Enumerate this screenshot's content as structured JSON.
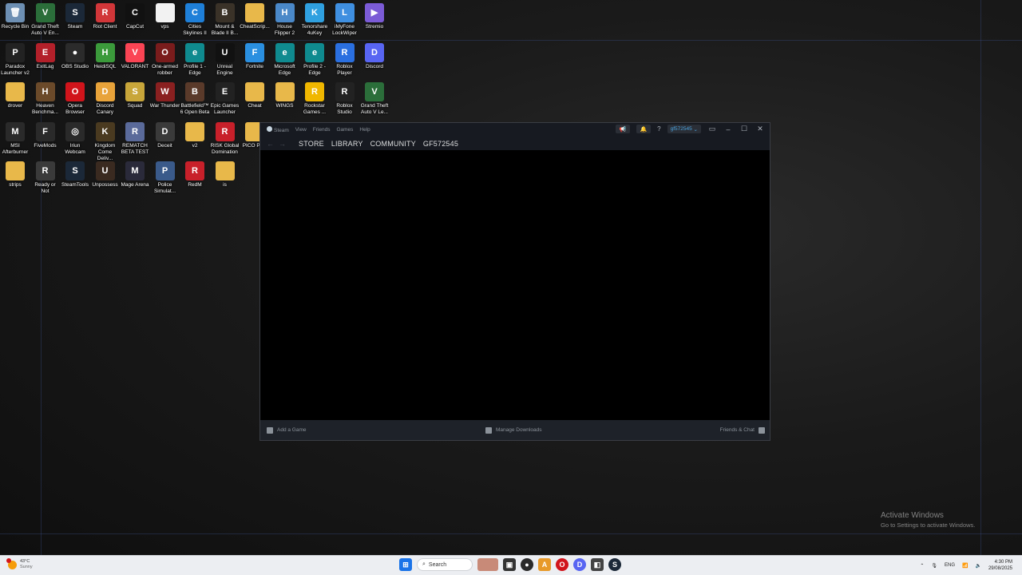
{
  "desktop": {
    "icons": [
      {
        "label": "Recycle Bin",
        "glyph": "🗑",
        "color": "#6d8fb3",
        "col": 0,
        "row": 0
      },
      {
        "label": "Grand Theft Auto V En...",
        "glyph": "V",
        "color": "#2b6e3a",
        "col": 1,
        "row": 0
      },
      {
        "label": "Steam",
        "glyph": "S",
        "color": "#1b2838",
        "col": 2,
        "row": 0
      },
      {
        "label": "Riot Client",
        "glyph": "R",
        "color": "#d13639",
        "col": 3,
        "row": 0
      },
      {
        "label": "CapCut",
        "glyph": "C",
        "color": "#111111",
        "col": 4,
        "row": 0
      },
      {
        "label": "vps",
        "glyph": "",
        "color": "#f2f2f2",
        "col": 5,
        "row": 0
      },
      {
        "label": "Cities Skylines II",
        "glyph": "C",
        "color": "#1e7fd8",
        "col": 6,
        "row": 0
      },
      {
        "label": "Mount & Blade II B...",
        "glyph": "B",
        "color": "#3a3228",
        "col": 7,
        "row": 0
      },
      {
        "label": "CheatScrip...",
        "glyph": "",
        "color": "#e8b84a",
        "col": 8,
        "row": 0
      },
      {
        "label": "House Flipper 2",
        "glyph": "H",
        "color": "#4a88c8",
        "col": 9,
        "row": 0
      },
      {
        "label": "Tenorshare 4uKey",
        "glyph": "K",
        "color": "#2fa0e0",
        "col": 10,
        "row": 0
      },
      {
        "label": "iMyFone LockWiper",
        "glyph": "L",
        "color": "#3f8fe0",
        "col": 11,
        "row": 0
      },
      {
        "label": "Stremio",
        "glyph": "▶",
        "color": "#7b5bd6",
        "col": 12,
        "row": 0
      },
      {
        "label": "Paradox Launcher v2",
        "glyph": "P",
        "color": "#222222",
        "col": 0,
        "row": 1
      },
      {
        "label": "ExitLag",
        "glyph": "E",
        "color": "#b3202a",
        "col": 1,
        "row": 1
      },
      {
        "label": "OBS Studio",
        "glyph": "●",
        "color": "#2b2b2b",
        "col": 2,
        "row": 1
      },
      {
        "label": "HeidiSQL",
        "glyph": "H",
        "color": "#3b9a3b",
        "col": 3,
        "row": 1
      },
      {
        "label": "VALORANT",
        "glyph": "V",
        "color": "#fa4454",
        "col": 4,
        "row": 1
      },
      {
        "label": "One-armed robber",
        "glyph": "O",
        "color": "#7a1c1c",
        "col": 5,
        "row": 1
      },
      {
        "label": "Profile 1 - Edge",
        "glyph": "e",
        "color": "#0f8a8f",
        "col": 6,
        "row": 1
      },
      {
        "label": "Unreal Engine",
        "glyph": "U",
        "color": "#111111",
        "col": 7,
        "row": 1
      },
      {
        "label": "Fortnite",
        "glyph": "F",
        "color": "#2a8fe0",
        "col": 8,
        "row": 1
      },
      {
        "label": "Microsoft Edge",
        "glyph": "e",
        "color": "#0f8a8f",
        "col": 9,
        "row": 1
      },
      {
        "label": "Profile 2 - Edge",
        "glyph": "e",
        "color": "#0f8a8f",
        "col": 10,
        "row": 1
      },
      {
        "label": "Roblox Player",
        "glyph": "R",
        "color": "#2a6fe0",
        "col": 11,
        "row": 1
      },
      {
        "label": "Discord",
        "glyph": "D",
        "color": "#5865f2",
        "col": 12,
        "row": 1
      },
      {
        "label": "drover",
        "glyph": "",
        "color": "#e8b84a",
        "col": 0,
        "row": 2
      },
      {
        "label": "Heaven Benchma...",
        "glyph": "H",
        "color": "#6b4a2a",
        "col": 1,
        "row": 2
      },
      {
        "label": "Opera Browser",
        "glyph": "O",
        "color": "#d1141b",
        "col": 2,
        "row": 2
      },
      {
        "label": "Discord Canary",
        "glyph": "D",
        "color": "#e8a33a",
        "col": 3,
        "row": 2
      },
      {
        "label": "Squad",
        "glyph": "S",
        "color": "#c8a63a",
        "col": 4,
        "row": 2
      },
      {
        "label": "War Thunder",
        "glyph": "W",
        "color": "#8a2020",
        "col": 5,
        "row": 2
      },
      {
        "label": "Battlefield™ 6 Open Beta",
        "glyph": "B",
        "color": "#5a3a2a",
        "col": 6,
        "row": 2
      },
      {
        "label": "Epic Games Launcher",
        "glyph": "E",
        "color": "#222222",
        "col": 7,
        "row": 2
      },
      {
        "label": "Cheat",
        "glyph": "",
        "color": "#e8b84a",
        "col": 8,
        "row": 2
      },
      {
        "label": "WINGS",
        "glyph": "",
        "color": "#e8b84a",
        "col": 9,
        "row": 2
      },
      {
        "label": "Rockstar Games ...",
        "glyph": "R",
        "color": "#f0b700",
        "col": 10,
        "row": 2
      },
      {
        "label": "Roblox Studio",
        "glyph": "R",
        "color": "#222222",
        "col": 11,
        "row": 2
      },
      {
        "label": "Grand Theft Auto V Le...",
        "glyph": "V",
        "color": "#2b6e3a",
        "col": 12,
        "row": 2
      },
      {
        "label": "MSI Afterburner",
        "glyph": "M",
        "color": "#2a2a2a",
        "col": 0,
        "row": 3
      },
      {
        "label": "FiveMods",
        "glyph": "F",
        "color": "#2a2a2a",
        "col": 1,
        "row": 3
      },
      {
        "label": "Iriun Webcam",
        "glyph": "◎",
        "color": "#2a2a2a",
        "col": 2,
        "row": 3
      },
      {
        "label": "Kingdom Come Deliv...",
        "glyph": "K",
        "color": "#4a3a20",
        "col": 3,
        "row": 3
      },
      {
        "label": "REMATCH BETA TEST",
        "glyph": "R",
        "color": "#5a6a9a",
        "col": 4,
        "row": 3
      },
      {
        "label": "Deceit",
        "glyph": "D",
        "color": "#3a3a3a",
        "col": 5,
        "row": 3
      },
      {
        "label": "v2",
        "glyph": "",
        "color": "#e8b84a",
        "col": 6,
        "row": 3
      },
      {
        "label": "RISK Global Domination",
        "glyph": "R",
        "color": "#c8202a",
        "col": 7,
        "row": 3
      },
      {
        "label": "PICO PAR",
        "glyph": "",
        "color": "#e8b84a",
        "col": 8,
        "row": 3
      },
      {
        "label": "strips",
        "glyph": "",
        "color": "#e8b84a",
        "col": 0,
        "row": 4
      },
      {
        "label": "Ready or Not",
        "glyph": "R",
        "color": "#3a3a3a",
        "col": 1,
        "row": 4
      },
      {
        "label": "SteamTools",
        "glyph": "S",
        "color": "#1b2838",
        "col": 2,
        "row": 4
      },
      {
        "label": "Unpossess",
        "glyph": "U",
        "color": "#3a2a20",
        "col": 3,
        "row": 4
      },
      {
        "label": "Mage Arena",
        "glyph": "M",
        "color": "#2a2a3a",
        "col": 4,
        "row": 4
      },
      {
        "label": "Police Simulat...",
        "glyph": "P",
        "color": "#3a5a8a",
        "col": 5,
        "row": 4
      },
      {
        "label": "RedM",
        "glyph": "R",
        "color": "#c8202a",
        "col": 6,
        "row": 4
      },
      {
        "label": "is",
        "glyph": "",
        "color": "#e8b84a",
        "col": 7,
        "row": 4
      }
    ]
  },
  "steam": {
    "menu": {
      "app": "Steam",
      "view": "View",
      "friends": "Friends",
      "games": "Games",
      "help": "Help"
    },
    "username": "gf572545",
    "help_glyph": "?",
    "tabs": {
      "store": "STORE",
      "library": "LIBRARY",
      "community": "COMMUNITY",
      "profile": "GF572545"
    },
    "footer": {
      "add_game": "Add a Game",
      "manage_downloads": "Manage Downloads",
      "friends_chat": "Friends & Chat"
    }
  },
  "activation": {
    "line1": "Activate Windows",
    "line2": "Go to Settings to activate Windows."
  },
  "taskbar": {
    "weather_temp": "43°C",
    "weather_desc": "Sunny",
    "search_placeholder": "Search",
    "language": "ENG",
    "time": "4:30 PM",
    "date": "29/08/2025"
  },
  "colors": {
    "steam_bg": "#171a21",
    "accent": "#4aa3df",
    "taskbar": "#eceef2"
  }
}
